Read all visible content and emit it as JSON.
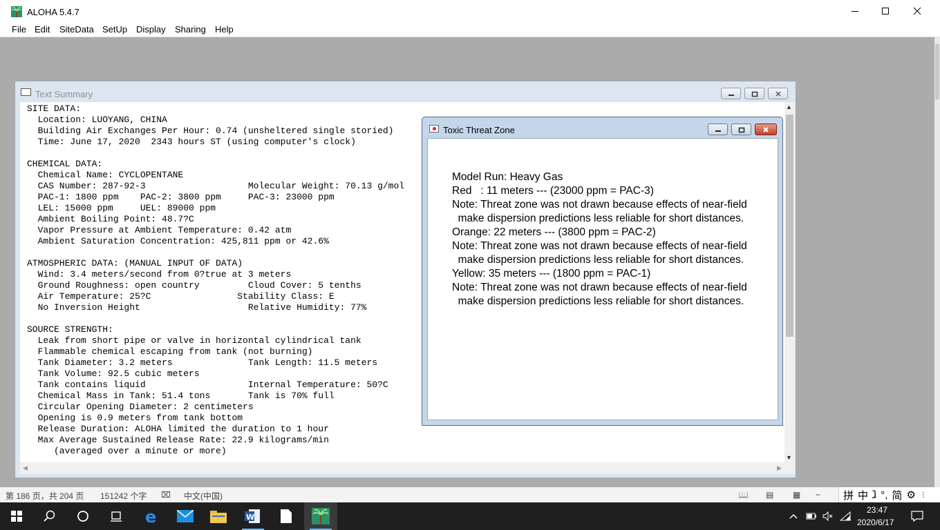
{
  "app": {
    "title": "ALOHA 5.4.7",
    "menu": [
      "File",
      "Edit",
      "SiteData",
      "SetUp",
      "Display",
      "Sharing",
      "Help"
    ]
  },
  "text_summary": {
    "title": "Text Summary",
    "lines": [
      "SITE DATA:",
      "  Location: LUOYANG, CHINA",
      "  Building Air Exchanges Per Hour: 0.74 (unsheltered single storied)",
      "  Time: June 17, 2020  2343 hours ST (using computer's clock)",
      "",
      "CHEMICAL DATA:",
      "  Chemical Name: CYCLOPENTANE",
      "  CAS Number: 287-92-3                   Molecular Weight: 70.13 g/mol",
      "  PAC-1: 1800 ppm    PAC-2: 3800 ppm     PAC-3: 23000 ppm",
      "  LEL: 15000 ppm     UEL: 89000 ppm",
      "  Ambient Boiling Point: 48.7?C",
      "  Vapor Pressure at Ambient Temperature: 0.42 atm",
      "  Ambient Saturation Concentration: 425,811 ppm or 42.6%",
      "",
      "ATMOSPHERIC DATA: (MANUAL INPUT OF DATA)",
      "  Wind: 3.4 meters/second from 0?true at 3 meters",
      "  Ground Roughness: open country         Cloud Cover: 5 tenths",
      "  Air Temperature: 25?C                Stability Class: E",
      "  No Inversion Height                    Relative Humidity: 77%",
      "",
      "SOURCE STRENGTH:",
      "  Leak from short pipe or valve in horizontal cylindrical tank",
      "  Flammable chemical escaping from tank (not burning)",
      "  Tank Diameter: 3.2 meters              Tank Length: 11.5 meters",
      "  Tank Volume: 92.5 cubic meters",
      "  Tank contains liquid                   Internal Temperature: 50?C",
      "  Chemical Mass in Tank: 51.4 tons       Tank is 70% full",
      "  Circular Opening Diameter: 2 centimeters",
      "  Opening is 0.9 meters from tank bottom",
      "  Release Duration: ALOHA limited the duration to 1 hour",
      "  Max Average Sustained Release Rate: 22.9 kilograms/min",
      "     (averaged over a minute or more)"
    ]
  },
  "threat_zone": {
    "title": "Toxic Threat Zone",
    "lines": [
      "Model Run: Heavy Gas",
      "Red   : 11 meters --- (23000 ppm = PAC-3)",
      "Note: Threat zone was not drawn because effects of near-field",
      "  make dispersion predictions less reliable for short distances.",
      "Orange: 22 meters --- (3800 ppm = PAC-2)",
      "Note: Threat zone was not drawn because effects of near-field",
      "  make dispersion predictions less reliable for short distances.",
      "Yellow: 35 meters --- (1800 ppm = PAC-1)",
      "Note: Threat zone was not drawn because effects of near-field",
      "  make dispersion predictions less reliable for short distances."
    ]
  },
  "word_status": {
    "page": "第 186 页，共 204 页",
    "words": "151242 个字",
    "language": "中文(中国)"
  },
  "ime": [
    "拼",
    "中",
    "ⱹ",
    "°,",
    "简"
  ],
  "taskbar": {
    "time": "23:47",
    "date": "2020/6/17"
  },
  "colors": {
    "taskbar": "#1f1f1f",
    "mdi_background": "#ababab",
    "close_red": "#c2402a"
  }
}
